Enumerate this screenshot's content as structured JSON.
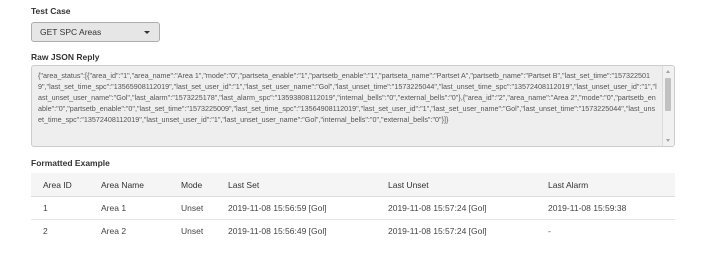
{
  "test_case": {
    "label": "Test Case",
    "selected": "GET SPC Areas"
  },
  "raw_json": {
    "label": "Raw JSON Reply",
    "content": "{\"area_status\":[{\"area_id\":\"1\",\"area_name\":\"Area 1\",\"mode\":\"0\",\"partseta_enable\":\"1\",\"partsetb_enable\":\"1\",\"partseta_name\":\"Partset A\",\"partsetb_name\":\"Partset B\",\"last_set_time\":\"1573225019\",\"last_set_time_spc\":\"13565908112019\",\"last_set_user_id\":\"1\",\"last_set_user_name\":\"Gol\",\"last_unset_time\":\"1573225044\",\"last_unset_time_spc\":\"13572408112019\",\"last_unset_user_id\":\"1\",\"last_unset_user_name\":\"Gol\",\"last_alarm\":\"1573225178\",\"last_alarm_spc\":\"13593808112019\",\"internal_bells\":\"0\",\"external_bells\":\"0\"},{\"area_id\":\"2\",\"area_name\":\"Area 2\",\"mode\":\"0\",\"partsetb_enable\":\"0\",\"partsetb_enable\":\"0\",\"last_set_time\":\"1573225009\",\"last_set_time_spc\":\"13564908112019\",\"last_set_user_id\":\"1\",\"last_set_user_name\":\"Gol\",\"last_unset_time\":\"1573225044\",\"last_unset_time_spc\":\"13572408112019\",\"last_unset_user_id\":\"1\",\"last_unset_user_name\":\"Gol\",\"internal_bells\":\"0\",\"external_bells\":\"0\"}]}"
  },
  "formatted": {
    "label": "Formatted Example",
    "headers": [
      "Area ID",
      "Area Name",
      "Mode",
      "Last Set",
      "Last Unset",
      "Last Alarm"
    ],
    "rows": [
      [
        "1",
        "Area 1",
        "Unset",
        "2019-11-08 15:56:59 [Gol]",
        "2019-11-08 15:57:24 [Gol]",
        "2019-11-08 15:59:38"
      ],
      [
        "2",
        "Area 2",
        "Unset",
        "2019-11-08 15:56:49 [Gol]",
        "2019-11-08 15:57:24 [Gol]",
        "-"
      ]
    ]
  }
}
